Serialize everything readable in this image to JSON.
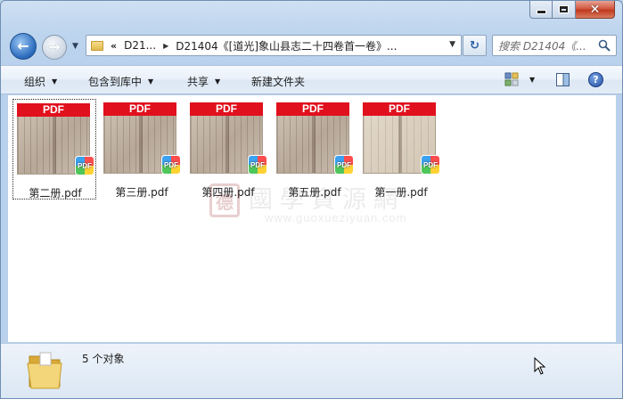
{
  "window": {
    "close_glyph": "✕"
  },
  "nav": {
    "back_glyph": "←",
    "forward_glyph": "→",
    "address_chevron": "«",
    "address_segments": [
      "D21...",
      "D21404《[道光]象山县志二十四卷首一卷》..."
    ],
    "refresh_glyph": "↻",
    "search_placeholder": "搜索 D21404《..."
  },
  "toolbar": {
    "organize": "组织",
    "include_in_library": "包含到库中",
    "share": "共享",
    "new_folder": "新建文件夹",
    "help_glyph": "?"
  },
  "files": [
    {
      "name": "第二册.pdf",
      "selected": true
    },
    {
      "name": "第三册.pdf",
      "selected": false
    },
    {
      "name": "第四册.pdf",
      "selected": false
    },
    {
      "name": "第五册.pdf",
      "selected": false
    },
    {
      "name": "第一册.pdf",
      "selected": false
    }
  ],
  "thumbnail_banner": "PDF",
  "badge_text": "PDF",
  "watermark": {
    "seal": "德",
    "title": "國學資源網",
    "url": "www.guoxueziyuan.com"
  },
  "status": {
    "count_text": "5 个对象"
  },
  "colors": {
    "pdf_red": "#e1101d",
    "window_frame": "#bed5ee",
    "toolbar": "#e2ecf7"
  },
  "icons": [
    "back-arrow-icon",
    "forward-arrow-icon",
    "folder-icon",
    "refresh-icon",
    "search-icon",
    "view-options-icon",
    "preview-pane-icon",
    "help-icon",
    "pdf-badge-icon",
    "mouse-cursor-icon"
  ]
}
